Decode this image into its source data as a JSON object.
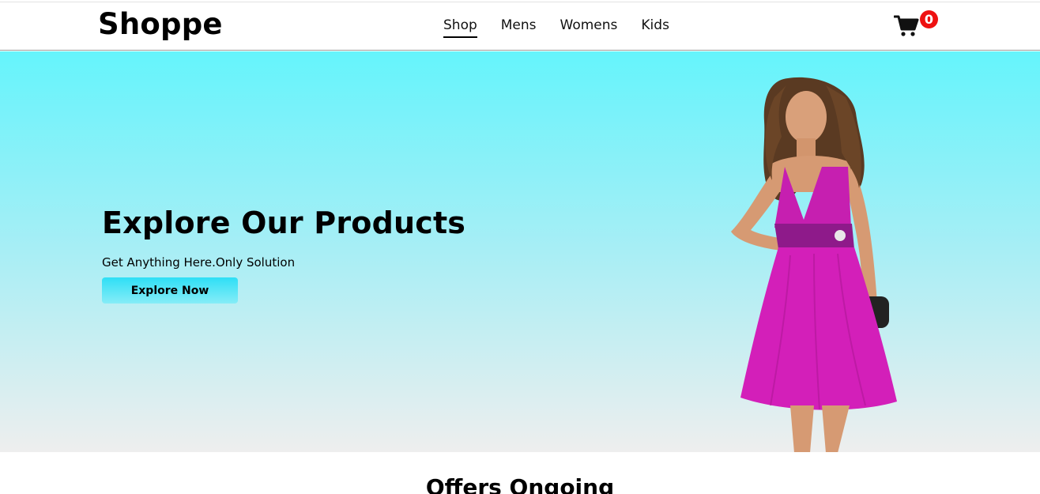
{
  "brand": {
    "name": "Shoppe"
  },
  "nav": {
    "items": [
      {
        "label": "Shop",
        "active": true
      },
      {
        "label": "Mens",
        "active": false
      },
      {
        "label": "Womens",
        "active": false
      },
      {
        "label": "Kids",
        "active": false
      }
    ]
  },
  "cart": {
    "count": "0",
    "icon": "cart-icon",
    "badge_color": "#ee1111"
  },
  "hero": {
    "title": "Explore Our Products",
    "subtitle": "Get Anything Here.Only Solution",
    "button_label": "Explore Now",
    "gradient_top": "#65f4fc",
    "gradient_bottom": "#eeeeee",
    "image": "model-in-pink-dress"
  },
  "offers": {
    "title": "Offers Ongoing"
  }
}
